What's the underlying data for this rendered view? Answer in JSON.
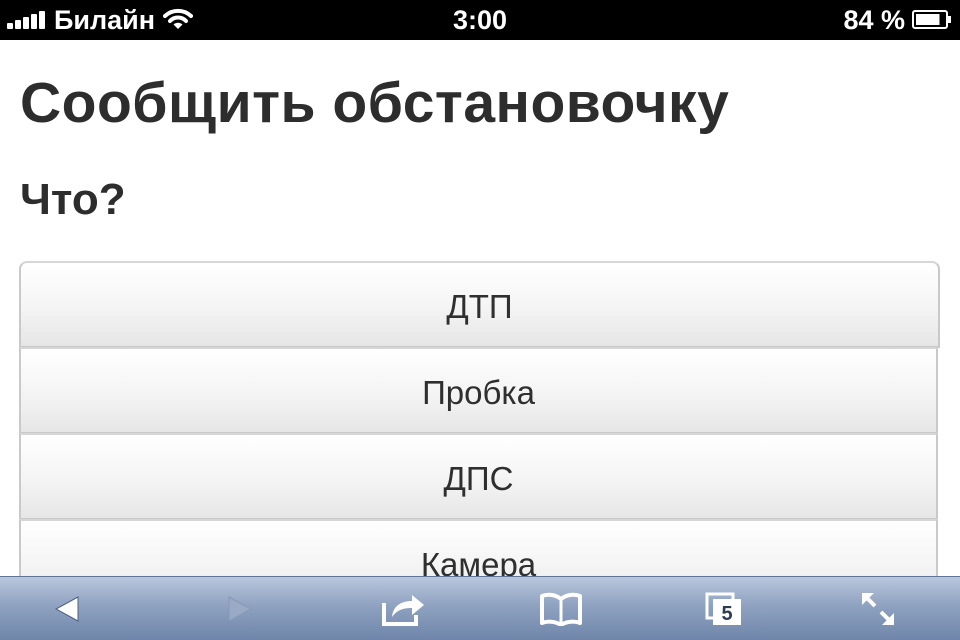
{
  "status_bar": {
    "carrier": "Билайн",
    "time": "3:00",
    "battery_percent": "84 %",
    "battery_level": 0.84,
    "signal_bars": 5
  },
  "page": {
    "title": "Сообщить обстановочку",
    "section_title": "Что?",
    "options": [
      "ДТП",
      "Пробка",
      "ДПС",
      "Камера"
    ]
  },
  "toolbar": {
    "items": [
      "back-icon",
      "forward-icon",
      "share-icon",
      "bookmarks-icon",
      "tabs-icon",
      "fullscreen-icon"
    ],
    "tabs_count": "5",
    "forward_enabled": false
  },
  "colors": {
    "toolbar_top": "#b9c7dd",
    "toolbar_bottom": "#6f86aa",
    "text": "#2d2d2d",
    "status_bar": "#000000"
  }
}
